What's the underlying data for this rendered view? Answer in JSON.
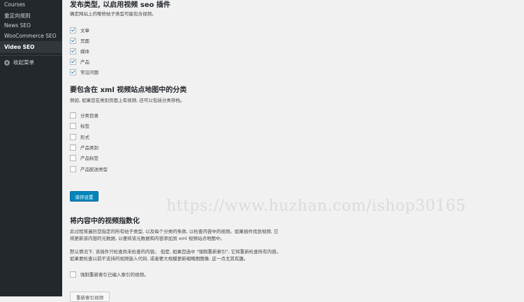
{
  "sidebar": {
    "items": [
      {
        "label": "Courses"
      },
      {
        "label": "重定向规则"
      },
      {
        "label": "News SEO"
      },
      {
        "label": "WooCommerce SEO"
      },
      {
        "label": "Video SEO"
      }
    ],
    "collapse_label": "收起菜单"
  },
  "post_types": {
    "title": "发布类型, 以启用视频 seo 插件",
    "description": "确定网站上的哪些帖子类型可能包含视频。",
    "options": [
      {
        "label": "文章",
        "checked": true
      },
      {
        "label": "页面",
        "checked": true
      },
      {
        "label": "媒体",
        "checked": true
      },
      {
        "label": "产品",
        "checked": true
      },
      {
        "label": "常见问题",
        "checked": true
      }
    ]
  },
  "taxonomies": {
    "title": "要包含在 xml 视频站点地图中的分类",
    "description": "例如, 如果您在类别页面上有视频, 还可以包括分类存档。",
    "options": [
      {
        "label": "分类目录",
        "checked": false
      },
      {
        "label": "标签",
        "checked": false
      },
      {
        "label": "形式",
        "checked": false
      },
      {
        "label": "产品类别",
        "checked": false
      },
      {
        "label": "产品标签",
        "checked": false
      },
      {
        "label": "产品配送类型",
        "checked": false
      }
    ]
  },
  "save_button": "保存设置",
  "watermark": "https://www.huzhan.com/ishop30165",
  "indexing": {
    "title": "将内容中的视频指数化",
    "para1_line1": "此过程将遍历您指定的所有帖子类型, 以及每个分类的条款, 以检查内容中的视频。如果插件找到视频, 它",
    "para1_line2": "将更新该内容的元数据, 以便将该元数据和内容添加到 xml 视频站点地图中。",
    "para2_line1": "默认情况下, 该插件只检查尚未检查的内容。 但是, 如果您选中 \"强制重新索引\", 它将重新检查所有内容。",
    "para2_line2": "如果要检查以前不支持的视频嵌入代码, 或者要大规模更新缩略图图像, 这一点尤其有趣。",
    "force_label": "强制重新索引已编入索引的视频。",
    "force_checked": false,
    "reindex_button": "重新索引视频"
  },
  "colors": {
    "sidebar_bg": "#23282d",
    "primary_button": "#0085ba",
    "check_mark": "#1e8cbe",
    "content_bg": "#f1f1f1"
  }
}
